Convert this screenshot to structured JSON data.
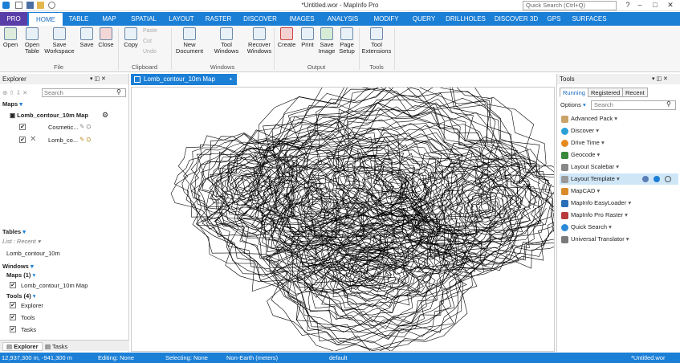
{
  "window": {
    "title": "*Untitled.wor - MapInfo Pro",
    "quick_search_placeholder": "Quick Search (Ctrl+Q)"
  },
  "tabs": [
    "PRO",
    "HOME",
    "TABLE",
    "MAP",
    "SPATIAL",
    "LAYOUT",
    "RASTER",
    "DISCOVER",
    "IMAGES",
    "ANALYSIS",
    "MODIFY",
    "QUERY",
    "DRILLHOLES",
    "DISCOVER 3D",
    "GPS",
    "SURFACES"
  ],
  "ribbon": {
    "buttons": [
      "Open",
      "Open Table",
      "Save Workspace",
      "Save",
      "Close",
      "Copy",
      "New Document",
      "Tool Windows",
      "Recover Windows",
      "Create",
      "Print",
      "Save Image",
      "Page Setup",
      "Tool Extensions"
    ],
    "small": [
      "Paste",
      "Cut",
      "Undo"
    ],
    "groups": [
      "File",
      "Clipboard",
      "Windows",
      "Output",
      "Tools"
    ]
  },
  "explorer": {
    "title": "Explorer",
    "search_placeholder": "Search",
    "maps_header": "Maps",
    "map_name": "Lomb_contour_10m Map",
    "layers": [
      "Cosmetic...",
      "Lomb_co..."
    ],
    "tables_header": "Tables",
    "list_label": "List : Recent",
    "table_item": "Lomb_contour_10m",
    "windows_header": "Windows",
    "maps_count": "Maps (1)",
    "map_window": "Lomb_contour_10m Map",
    "tools_count": "Tools (4)",
    "tool_windows": [
      "Explorer",
      "Tools",
      "Tasks"
    ],
    "bottom_tabs": [
      "Explorer",
      "Tasks"
    ]
  },
  "document": {
    "tab": "Lomb_contour_10m Map"
  },
  "tools_panel": {
    "title": "Tools",
    "tabs": [
      "Running",
      "Registered",
      "Recent"
    ],
    "options": "Options",
    "search_placeholder": "Search",
    "items": [
      "Advanced Pack",
      "Discover",
      "Drive Time",
      "Geocode",
      "Layout Scalebar",
      "Layout Template",
      "MapCAD",
      "MapInfo EasyLoader",
      "MapInfo Pro Raster",
      "Quick Search",
      "Universal Translator"
    ],
    "colors": {
      "highlight": "#cfe6f7",
      "accent": "#1b7fd6"
    }
  },
  "status": {
    "coords": "12,937,300 m, -941,300 m",
    "editing": "Editing: None",
    "selecting": "Selecting: None",
    "projection": "Non-Earth (meters)",
    "style": "default",
    "workspace": "*Untitled.wor"
  }
}
